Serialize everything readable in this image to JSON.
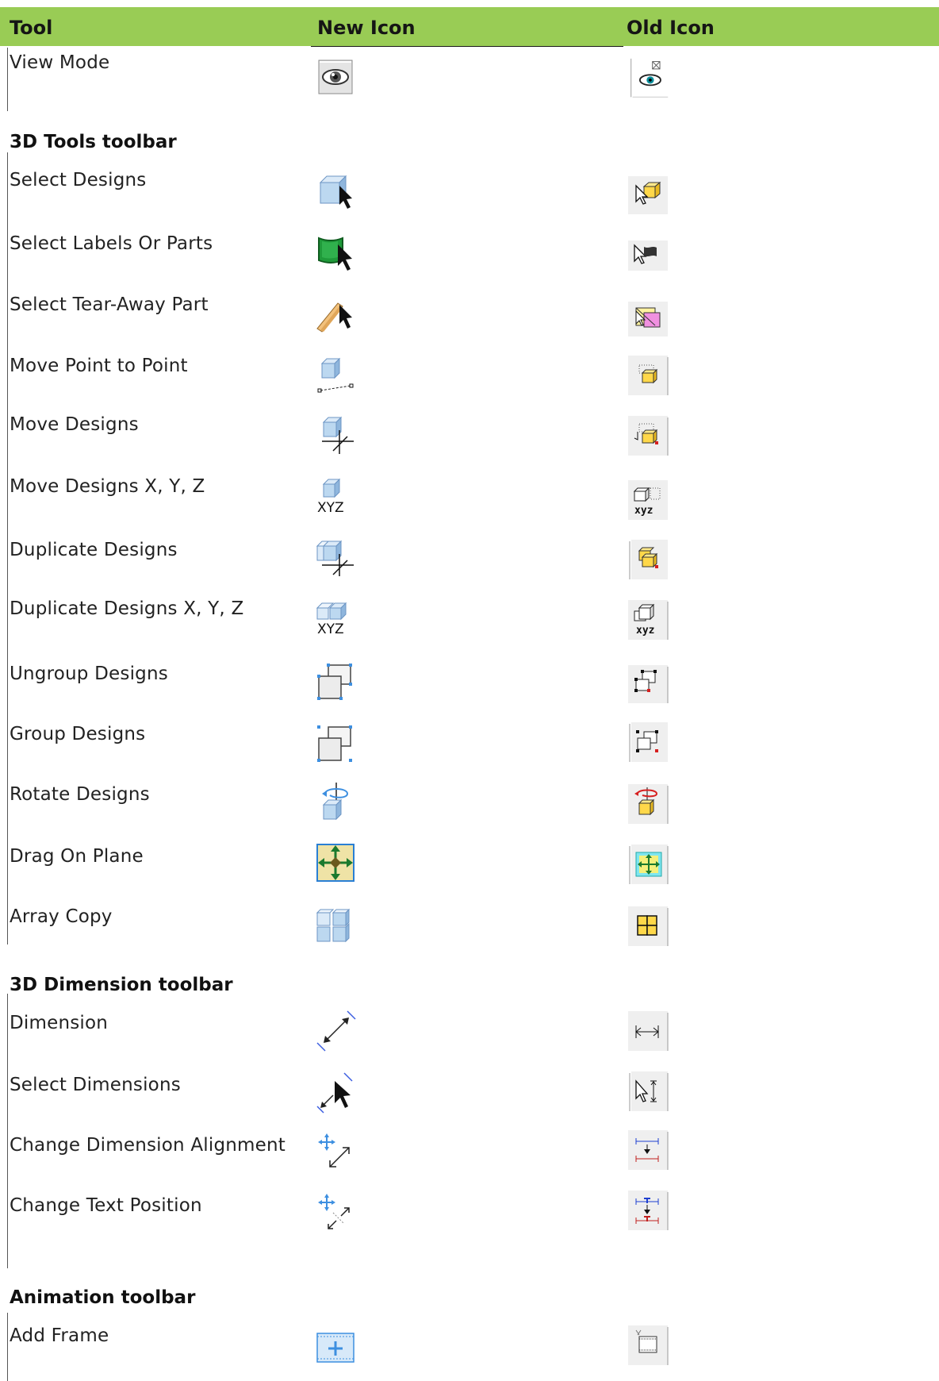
{
  "columns": {
    "tool": "Tool",
    "new_icon": "New Icon",
    "old_icon": "Old Icon"
  },
  "rows": {
    "view_mode": "View Mode",
    "sec_3d_tools": "3D Tools toolbar",
    "select_designs": "Select Designs",
    "select_labels": "Select Labels Or Parts",
    "select_tearaway": "Select Tear-Away Part",
    "move_p2p": "Move Point to Point",
    "move_designs": "Move Designs",
    "move_xyz": "Move Designs X, Y, Z",
    "dup_designs": "Duplicate Designs",
    "dup_xyz": "Duplicate Designs X, Y, Z",
    "ungroup": "Ungroup Designs",
    "group": "Group Designs",
    "rotate": "Rotate Designs",
    "drag_plane": "Drag On Plane",
    "array_copy": "Array Copy",
    "sec_3d_dim": "3D Dimension toolbar",
    "dimension": "Dimension",
    "select_dims": "Select Dimensions",
    "change_align": "Change Dimension Alignment",
    "change_text": "Change Text Position",
    "sec_animation": "Animation toolbar",
    "add_frame": "Add Frame"
  },
  "icon_text": {
    "xyz": "XYZ",
    "xyz_small": "xyz"
  },
  "colors": {
    "header_bg": "#99cc55",
    "cube_face": "#bcd8f0",
    "cube_top": "#dbeaf8",
    "cube_side": "#8fb6dd",
    "green_label": "#1f9a3a",
    "handle_blue": "#3d8fe0",
    "accent_red": "#d62020",
    "old_bg": "#eeeeee"
  }
}
